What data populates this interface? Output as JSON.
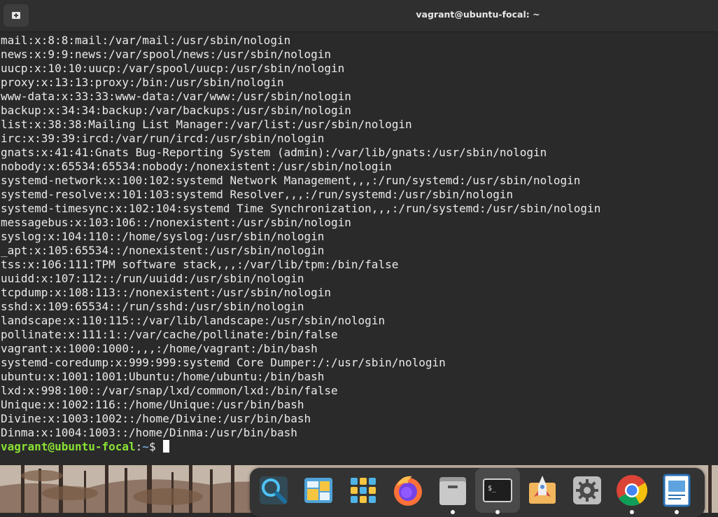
{
  "window": {
    "title": "vagrant@ubuntu-focal: ~",
    "new_tab_icon": "new-tab-icon"
  },
  "terminal": {
    "lines": [
      "mail:x:8:8:mail:/var/mail:/usr/sbin/nologin",
      "news:x:9:9:news:/var/spool/news:/usr/sbin/nologin",
      "uucp:x:10:10:uucp:/var/spool/uucp:/usr/sbin/nologin",
      "proxy:x:13:13:proxy:/bin:/usr/sbin/nologin",
      "www-data:x:33:33:www-data:/var/www:/usr/sbin/nologin",
      "backup:x:34:34:backup:/var/backups:/usr/sbin/nologin",
      "list:x:38:38:Mailing List Manager:/var/list:/usr/sbin/nologin",
      "irc:x:39:39:ircd:/var/run/ircd:/usr/sbin/nologin",
      "gnats:x:41:41:Gnats Bug-Reporting System (admin):/var/lib/gnats:/usr/sbin/nologin",
      "nobody:x:65534:65534:nobody:/nonexistent:/usr/sbin/nologin",
      "systemd-network:x:100:102:systemd Network Management,,,:/run/systemd:/usr/sbin/nologin",
      "systemd-resolve:x:101:103:systemd Resolver,,,:/run/systemd:/usr/sbin/nologin",
      "systemd-timesync:x:102:104:systemd Time Synchronization,,,:/run/systemd:/usr/sbin/nologin",
      "messagebus:x:103:106::/nonexistent:/usr/sbin/nologin",
      "syslog:x:104:110::/home/syslog:/usr/sbin/nologin",
      "_apt:x:105:65534::/nonexistent:/usr/sbin/nologin",
      "tss:x:106:111:TPM software stack,,,:/var/lib/tpm:/bin/false",
      "uuidd:x:107:112::/run/uuidd:/usr/sbin/nologin",
      "tcpdump:x:108:113::/nonexistent:/usr/sbin/nologin",
      "sshd:x:109:65534::/run/sshd:/usr/sbin/nologin",
      "landscape:x:110:115::/var/lib/landscape:/usr/sbin/nologin",
      "pollinate:x:111:1::/var/cache/pollinate:/bin/false",
      "vagrant:x:1000:1000:,,,:/home/vagrant:/bin/bash",
      "systemd-coredump:x:999:999:systemd Core Dumper:/:/usr/sbin/nologin",
      "ubuntu:x:1001:1001:Ubuntu:/home/ubuntu:/bin/bash",
      "lxd:x:998:100::/var/snap/lxd/common/lxd:/bin/false",
      "Unique:x:1002:116::/home/Unique:/usr/bin/bash",
      "Divine:x:1003:1002::/home/Divine:/usr/bin/bash",
      "Dinma:x:1004:1003::/home/Dinma:/usr/bin/bash"
    ],
    "prompt": {
      "user_host": "vagrant@ubuntu-focal",
      "separator": ":",
      "path": "~",
      "symbol": "$ "
    },
    "colors": {
      "background": "#2a2a2a",
      "text": "#eaeaea",
      "prompt_user": "#8ae234",
      "prompt_path": "#729fcf"
    }
  },
  "dock": {
    "items": [
      {
        "icon": "search-magnifier-icon",
        "running": false,
        "active": false
      },
      {
        "icon": "workspaces-icon",
        "running": false,
        "active": false
      },
      {
        "icon": "app-grid-icon",
        "running": false,
        "active": false
      },
      {
        "icon": "firefox-icon",
        "running": false,
        "active": false
      },
      {
        "icon": "files-icon",
        "running": true,
        "active": false
      },
      {
        "icon": "terminal-icon",
        "running": true,
        "active": true
      },
      {
        "icon": "rocket-launcher-icon",
        "running": false,
        "active": false
      },
      {
        "icon": "settings-gear-icon",
        "running": false,
        "active": false
      },
      {
        "icon": "chrome-icon",
        "running": true,
        "active": false
      },
      {
        "icon": "document-viewer-icon",
        "running": true,
        "active": false
      }
    ]
  }
}
